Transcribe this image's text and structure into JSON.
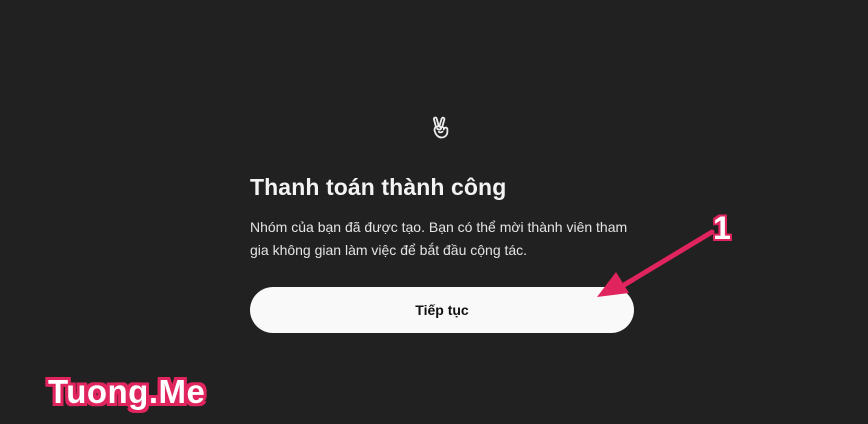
{
  "dialog": {
    "icon": "victory-hand-icon",
    "title": "Thanh toán thành công",
    "description": "Nhóm của bạn đã được tạo. Bạn có thể mời thành viên tham gia không gian làm việc để bắt đầu cộng tác.",
    "continue_label": "Tiếp tục"
  },
  "annotation": {
    "step_number": "1",
    "arrow_color": "#e0245e"
  },
  "watermark": {
    "text": "Tuong.Me",
    "color": "#e0245e"
  },
  "colors": {
    "background": "#212121",
    "button_bg": "#f9f9f9",
    "text": "#ececec"
  }
}
